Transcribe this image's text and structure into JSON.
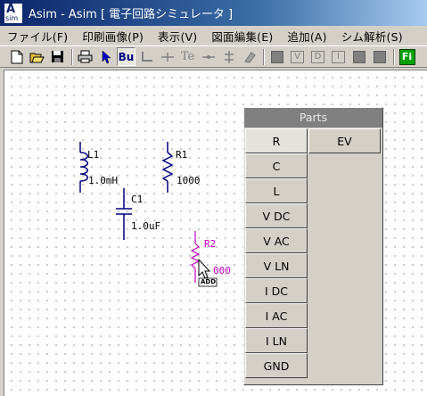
{
  "window": {
    "title": "Asim -   Asim [ 電子回路シミュレータ ]",
    "icon_top": "A",
    "icon_bottom": "sim"
  },
  "menu": [
    {
      "label": "ファイル(F)",
      "name": "menu-file"
    },
    {
      "label": "印刷画像(P)",
      "name": "menu-print-image"
    },
    {
      "label": "表示(V)",
      "name": "menu-view"
    },
    {
      "label": "図面編集(E)",
      "name": "menu-edit"
    },
    {
      "label": "追加(A)",
      "name": "menu-add"
    },
    {
      "label": "シム解析(S)",
      "name": "menu-sim-analysis"
    }
  ],
  "toolbar": {
    "bus_label": "Bu",
    "te_label": "Te",
    "v_label": "V",
    "d_label": "D",
    "i_label": "I",
    "fi_label": "Fi"
  },
  "schematic": {
    "l1_name": "L1",
    "l1_value": "1.0mH",
    "r1_name": "R1",
    "r1_value": "1000",
    "c1_name": "C1",
    "c1_value": "1.0uF",
    "r2_name": "R2",
    "r2_value": "000",
    "cursor_tag": "ADD",
    "colors": {
      "component": "#000080",
      "placing": "#c000c0"
    }
  },
  "parts": {
    "title": "Parts",
    "left": [
      "R",
      "C",
      "L",
      "V DC",
      "V AC",
      "V LN",
      "I DC",
      "I AC",
      "I LN",
      "GND"
    ],
    "right": [
      "EV"
    ],
    "selected": "R"
  }
}
